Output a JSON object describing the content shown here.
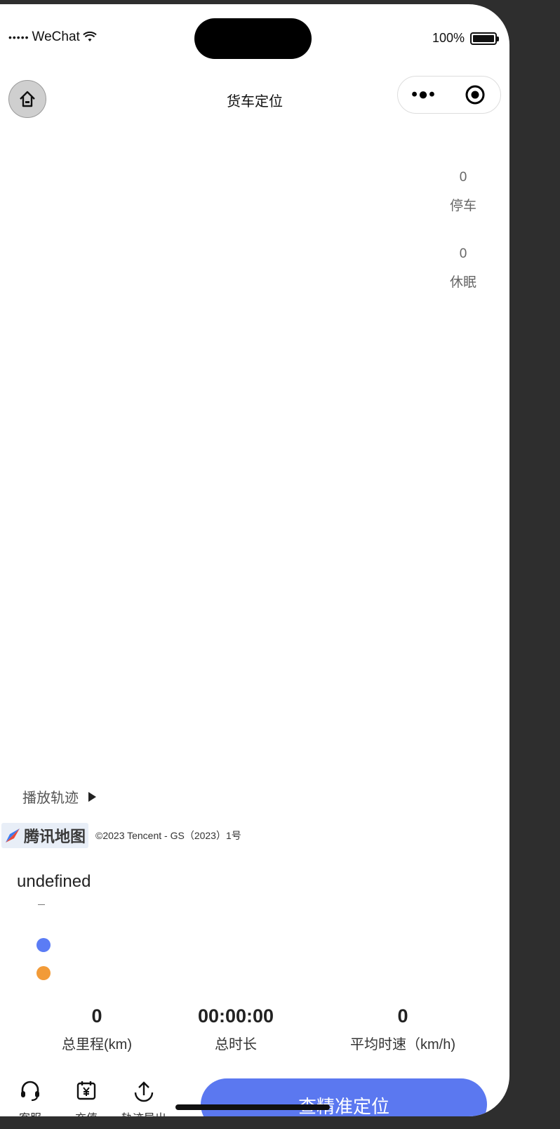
{
  "status_bar": {
    "signal": "•••••",
    "carrier": "WeChat",
    "battery_text": "100%"
  },
  "nav": {
    "title": "货车定位",
    "more": "•●•"
  },
  "side_stats": [
    {
      "value": "0",
      "label": "停车"
    },
    {
      "value": "0",
      "label": "休眠"
    }
  ],
  "play_track": {
    "label": "播放轨迹"
  },
  "map": {
    "logo_text": "腾讯地图",
    "copyright": "©2023 Tencent - GS（2023）1号"
  },
  "vehicle": {
    "name": "undefined",
    "legend_colors": [
      "#5b7cf5",
      "#f29b38"
    ]
  },
  "metrics": [
    {
      "value": "0",
      "label": "总里程(km)"
    },
    {
      "value": "00:00:00",
      "label": "总时长"
    },
    {
      "value": "0",
      "label": "平均时速（km/h)"
    }
  ],
  "bottom": {
    "icons": [
      {
        "icon": "headset-icon",
        "label": "客服"
      },
      {
        "icon": "recharge-icon",
        "label": "充值"
      },
      {
        "icon": "export-icon",
        "label": "轨迹导出"
      }
    ],
    "locate_button": "查精准定位"
  }
}
